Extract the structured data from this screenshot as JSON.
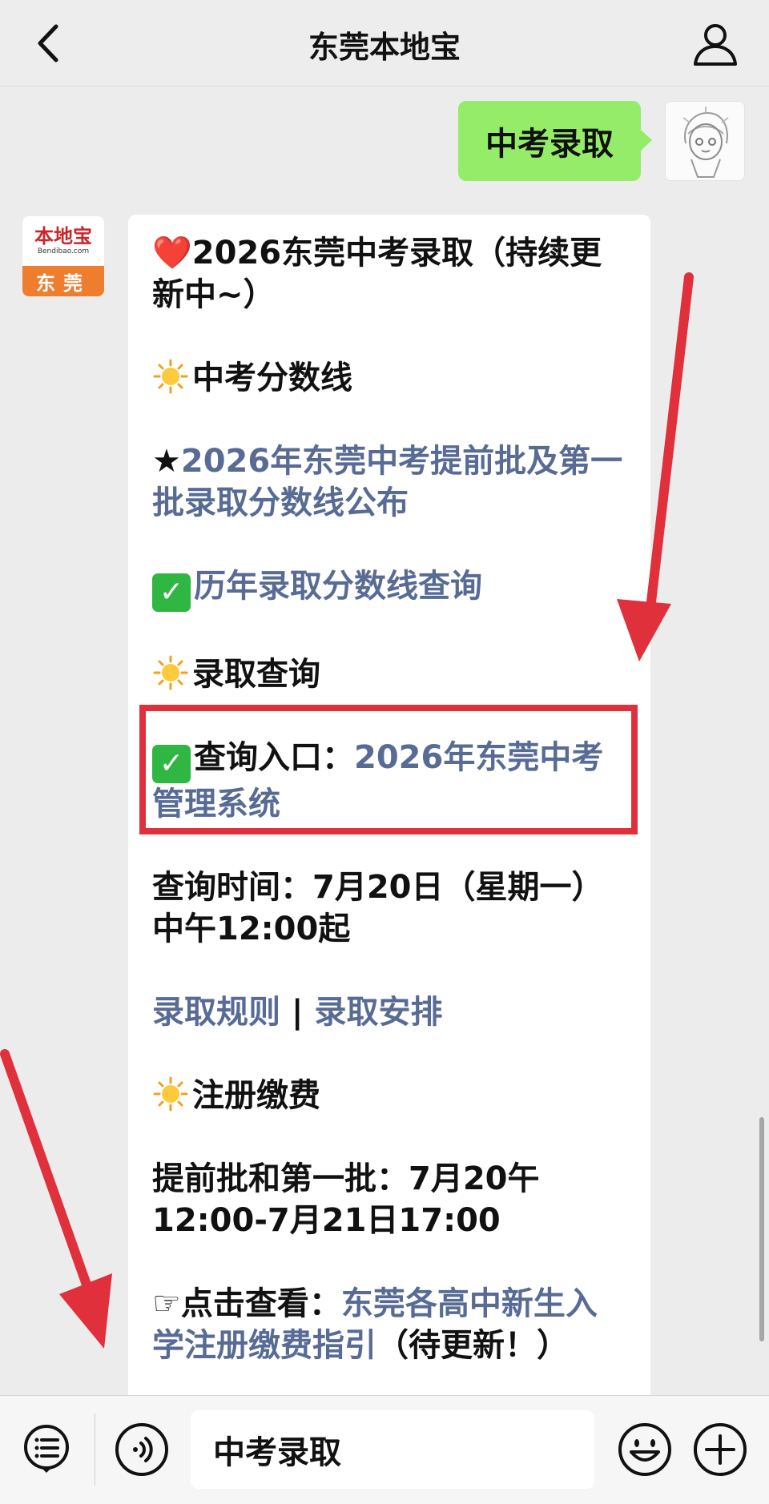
{
  "header": {
    "title": "东莞本地宝",
    "back_icon": "chevron-left-icon",
    "profile_icon": "person-icon"
  },
  "user_message": {
    "text": "中考录取"
  },
  "bot": {
    "avatar": {
      "logo_main": "本地宝",
      "logo_sub": "Bendibao.com",
      "logo_city": "东莞"
    },
    "message": {
      "title": "❤️2026东莞中考录取（持续更新中~）",
      "section_scores": "中考分数线",
      "star": "★",
      "link_scores": "2026年东莞中考提前批及第一批录取分数线公布",
      "link_history": "历年录取分数线查询",
      "section_query": "录取查询",
      "query_label": "查询入口：",
      "query_link": "2026年东莞中考管理系统",
      "query_time": "查询时间：7月20日（星期一）中午12:00起",
      "link_rules": "录取规则",
      "separator": " | ",
      "link_arrange": "录取安排",
      "section_register": "注册缴费",
      "register_time": "提前批和第一批：7月20午12:00-7月21日17:00",
      "pointer": "☞",
      "click_label": "点击查看：",
      "register_link": "东莞各高中新生入学注册缴费指引",
      "pending": "（待更新！）"
    }
  },
  "input_bar": {
    "value": "中考录取",
    "menu_icon": "menu-list-icon",
    "voice_icon": "voice-icon",
    "emoji_icon": "emoji-icon",
    "plus_icon": "plus-icon"
  },
  "colors": {
    "link": "#576b95",
    "user_bubble": "#95ec69",
    "highlight": "#e0303c",
    "check": "#30b743"
  }
}
